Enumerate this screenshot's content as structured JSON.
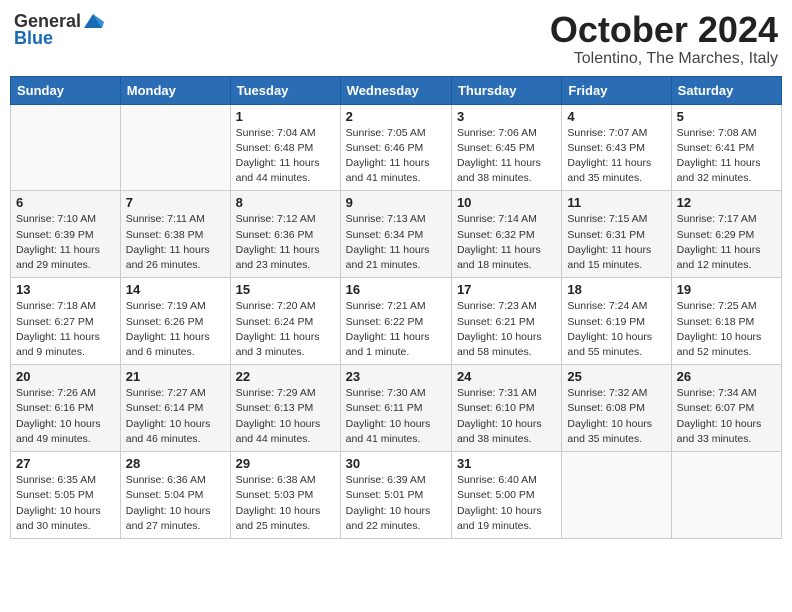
{
  "header": {
    "logo_general": "General",
    "logo_blue": "Blue",
    "month_title": "October 2024",
    "location": "Tolentino, The Marches, Italy"
  },
  "days_of_week": [
    "Sunday",
    "Monday",
    "Tuesday",
    "Wednesday",
    "Thursday",
    "Friday",
    "Saturday"
  ],
  "weeks": [
    [
      {
        "day": "",
        "info": ""
      },
      {
        "day": "",
        "info": ""
      },
      {
        "day": "1",
        "info": "Sunrise: 7:04 AM\nSunset: 6:48 PM\nDaylight: 11 hours and 44 minutes."
      },
      {
        "day": "2",
        "info": "Sunrise: 7:05 AM\nSunset: 6:46 PM\nDaylight: 11 hours and 41 minutes."
      },
      {
        "day": "3",
        "info": "Sunrise: 7:06 AM\nSunset: 6:45 PM\nDaylight: 11 hours and 38 minutes."
      },
      {
        "day": "4",
        "info": "Sunrise: 7:07 AM\nSunset: 6:43 PM\nDaylight: 11 hours and 35 minutes."
      },
      {
        "day": "5",
        "info": "Sunrise: 7:08 AM\nSunset: 6:41 PM\nDaylight: 11 hours and 32 minutes."
      }
    ],
    [
      {
        "day": "6",
        "info": "Sunrise: 7:10 AM\nSunset: 6:39 PM\nDaylight: 11 hours and 29 minutes."
      },
      {
        "day": "7",
        "info": "Sunrise: 7:11 AM\nSunset: 6:38 PM\nDaylight: 11 hours and 26 minutes."
      },
      {
        "day": "8",
        "info": "Sunrise: 7:12 AM\nSunset: 6:36 PM\nDaylight: 11 hours and 23 minutes."
      },
      {
        "day": "9",
        "info": "Sunrise: 7:13 AM\nSunset: 6:34 PM\nDaylight: 11 hours and 21 minutes."
      },
      {
        "day": "10",
        "info": "Sunrise: 7:14 AM\nSunset: 6:32 PM\nDaylight: 11 hours and 18 minutes."
      },
      {
        "day": "11",
        "info": "Sunrise: 7:15 AM\nSunset: 6:31 PM\nDaylight: 11 hours and 15 minutes."
      },
      {
        "day": "12",
        "info": "Sunrise: 7:17 AM\nSunset: 6:29 PM\nDaylight: 11 hours and 12 minutes."
      }
    ],
    [
      {
        "day": "13",
        "info": "Sunrise: 7:18 AM\nSunset: 6:27 PM\nDaylight: 11 hours and 9 minutes."
      },
      {
        "day": "14",
        "info": "Sunrise: 7:19 AM\nSunset: 6:26 PM\nDaylight: 11 hours and 6 minutes."
      },
      {
        "day": "15",
        "info": "Sunrise: 7:20 AM\nSunset: 6:24 PM\nDaylight: 11 hours and 3 minutes."
      },
      {
        "day": "16",
        "info": "Sunrise: 7:21 AM\nSunset: 6:22 PM\nDaylight: 11 hours and 1 minute."
      },
      {
        "day": "17",
        "info": "Sunrise: 7:23 AM\nSunset: 6:21 PM\nDaylight: 10 hours and 58 minutes."
      },
      {
        "day": "18",
        "info": "Sunrise: 7:24 AM\nSunset: 6:19 PM\nDaylight: 10 hours and 55 minutes."
      },
      {
        "day": "19",
        "info": "Sunrise: 7:25 AM\nSunset: 6:18 PM\nDaylight: 10 hours and 52 minutes."
      }
    ],
    [
      {
        "day": "20",
        "info": "Sunrise: 7:26 AM\nSunset: 6:16 PM\nDaylight: 10 hours and 49 minutes."
      },
      {
        "day": "21",
        "info": "Sunrise: 7:27 AM\nSunset: 6:14 PM\nDaylight: 10 hours and 46 minutes."
      },
      {
        "day": "22",
        "info": "Sunrise: 7:29 AM\nSunset: 6:13 PM\nDaylight: 10 hours and 44 minutes."
      },
      {
        "day": "23",
        "info": "Sunrise: 7:30 AM\nSunset: 6:11 PM\nDaylight: 10 hours and 41 minutes."
      },
      {
        "day": "24",
        "info": "Sunrise: 7:31 AM\nSunset: 6:10 PM\nDaylight: 10 hours and 38 minutes."
      },
      {
        "day": "25",
        "info": "Sunrise: 7:32 AM\nSunset: 6:08 PM\nDaylight: 10 hours and 35 minutes."
      },
      {
        "day": "26",
        "info": "Sunrise: 7:34 AM\nSunset: 6:07 PM\nDaylight: 10 hours and 33 minutes."
      }
    ],
    [
      {
        "day": "27",
        "info": "Sunrise: 6:35 AM\nSunset: 5:05 PM\nDaylight: 10 hours and 30 minutes."
      },
      {
        "day": "28",
        "info": "Sunrise: 6:36 AM\nSunset: 5:04 PM\nDaylight: 10 hours and 27 minutes."
      },
      {
        "day": "29",
        "info": "Sunrise: 6:38 AM\nSunset: 5:03 PM\nDaylight: 10 hours and 25 minutes."
      },
      {
        "day": "30",
        "info": "Sunrise: 6:39 AM\nSunset: 5:01 PM\nDaylight: 10 hours and 22 minutes."
      },
      {
        "day": "31",
        "info": "Sunrise: 6:40 AM\nSunset: 5:00 PM\nDaylight: 10 hours and 19 minutes."
      },
      {
        "day": "",
        "info": ""
      },
      {
        "day": "",
        "info": ""
      }
    ]
  ]
}
